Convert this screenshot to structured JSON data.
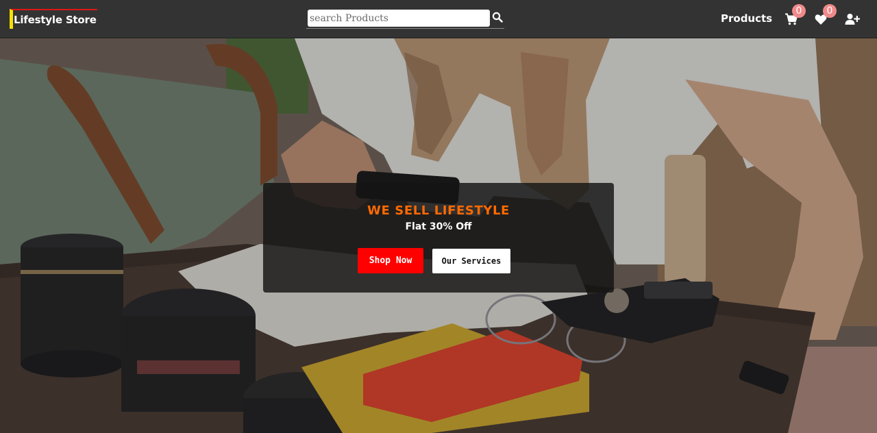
{
  "navbar": {
    "brand": "Lifestyle Store",
    "search": {
      "placeholder": "search Products",
      "value": ""
    },
    "products_label": "Products",
    "cart_count": "0",
    "wishlist_count": "0"
  },
  "hero": {
    "title": "WE SELL LIFESTYLE",
    "subtitle": "Flat 30% Off",
    "primary_button": "Shop Now",
    "secondary_button": "Our Services"
  },
  "icons": {
    "search": "search-icon",
    "cart": "cart-icon",
    "wishlist": "heart-icon",
    "account": "user-plus-icon"
  },
  "colors": {
    "navbar_bg": "#333333",
    "brand_top_border": "#e21414",
    "brand_left_border": "#f5e000",
    "badge": "#f08a8a",
    "hero_title": "#ff6a00",
    "shop_button": "#ff0000"
  }
}
